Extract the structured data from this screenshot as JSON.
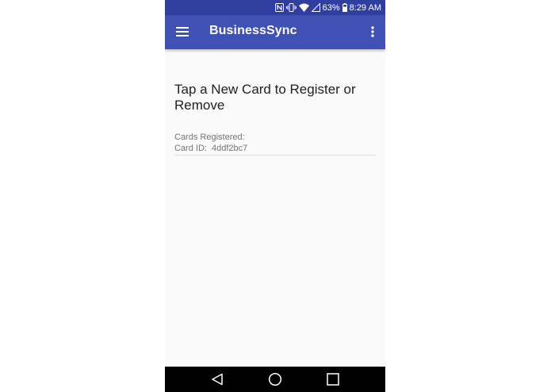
{
  "status_bar": {
    "battery_percent": "63%",
    "time": "8:29 AM",
    "icons": [
      "nfc-icon",
      "vibrate-icon",
      "wifi-icon",
      "signal-icon",
      "battery-icon"
    ]
  },
  "app_bar": {
    "title": "BusinessSync",
    "menu_icon": "hamburger-menu-icon",
    "overflow_icon": "more-vert-icon"
  },
  "main": {
    "heading": "Tap a New Card to Register or Remove",
    "registered_label": "Cards Registered:",
    "card_id_label": "Card ID:",
    "card_id_value": "4ddf2bc7"
  },
  "nav_bar": {
    "icons": [
      "back-icon",
      "home-icon",
      "recents-icon"
    ]
  },
  "colors": {
    "status_bar": "#303f9f",
    "app_bar": "#3f51b5",
    "background": "#fafafa",
    "nav_bar": "#000000"
  }
}
